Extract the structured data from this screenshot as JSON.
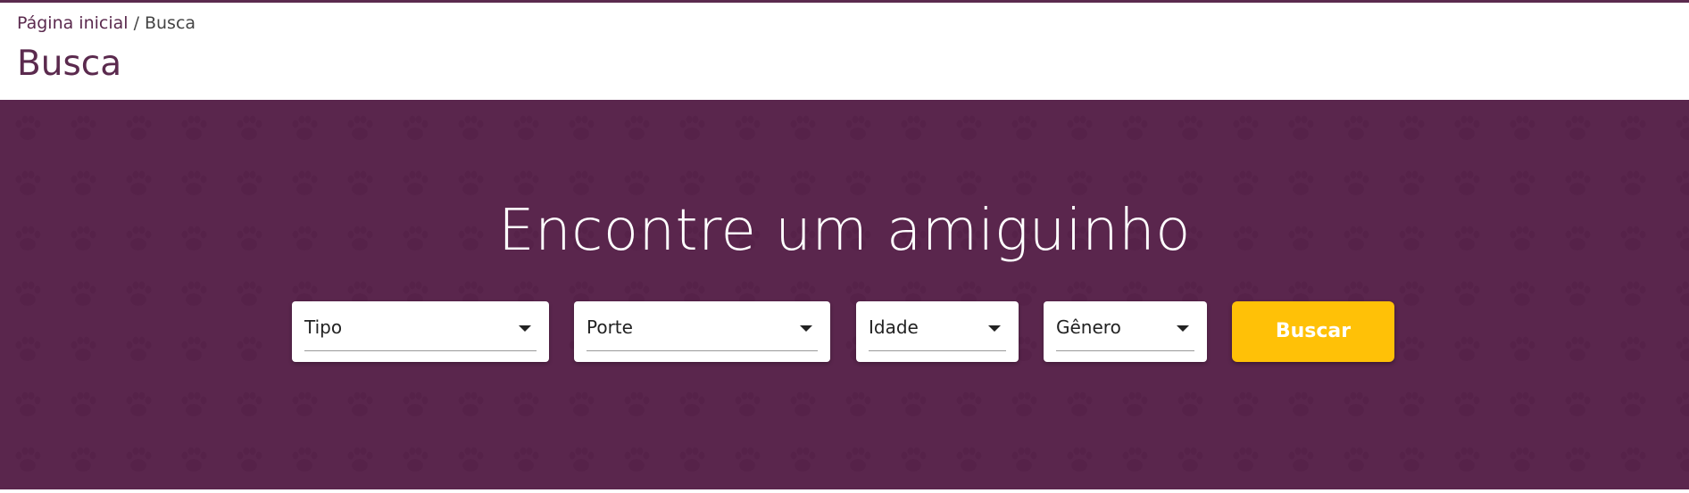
{
  "breadcrumb": {
    "home": "Página inicial",
    "separator": "/",
    "current": "Busca"
  },
  "page_title": "Busca",
  "hero": {
    "title": "Encontre um amiguinho",
    "filters": [
      {
        "label": "Tipo",
        "icon": "caret-down-icon"
      },
      {
        "label": "Porte",
        "icon": "caret-down-icon"
      },
      {
        "label": "Idade",
        "icon": "caret-down-icon"
      },
      {
        "label": "Gênero",
        "icon": "caret-down-icon"
      }
    ],
    "search_button": "Buscar",
    "background_pattern": "paw-print-icon"
  },
  "colors": {
    "brand_purple": "#5b2a4e",
    "hero_background": "#5a264d",
    "button_yellow": "#ffc107"
  }
}
